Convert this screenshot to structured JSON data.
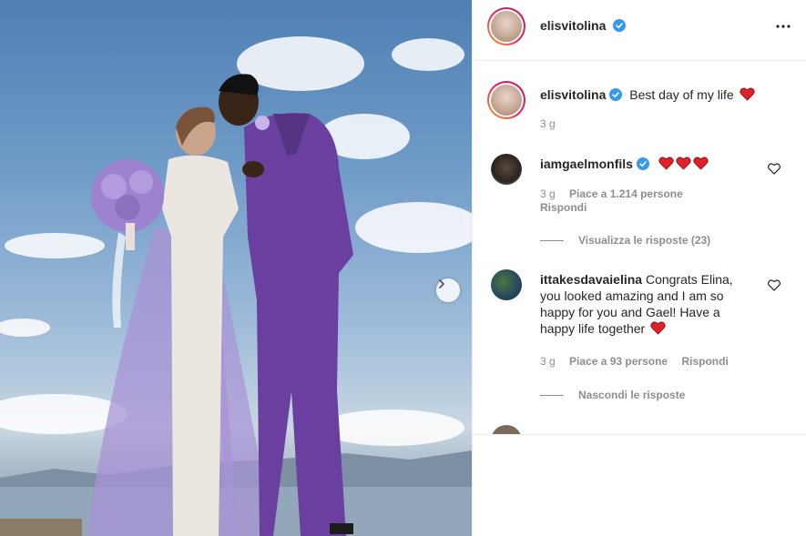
{
  "post": {
    "author": "elisvitolina",
    "caption": "Best day of my life",
    "caption_time": "3 g"
  },
  "comments": [
    {
      "user": "iamgaelmonfils",
      "text": "",
      "hearts": 3,
      "time": "3 g",
      "likes": "Piace a 1.214 persone",
      "reply": "Rispondi",
      "replies_toggle": "Visualizza le risposte (23)"
    },
    {
      "user": "ittakesdavaielina",
      "text": "Congrats Elina, you looked amazing and I am so happy for you and Gael! Have a happy life together",
      "hearts": 1,
      "time": "3 g",
      "likes": "Piace a 93 persone",
      "reply": "Rispondi",
      "replies_toggle": "Nascondi le risposte"
    }
  ],
  "icons": {
    "verified": "verified-badge-icon",
    "more": "more-options-icon",
    "next": "chevron-right-icon",
    "like": "heart-outline-icon",
    "heart_emoji": "red-heart-emoji"
  },
  "colors": {
    "verified": "#3897f0",
    "heart": "#e0202a",
    "muted": "#8e8e8e",
    "suit": "#6a3fa0",
    "tulle": "#a893d6"
  }
}
